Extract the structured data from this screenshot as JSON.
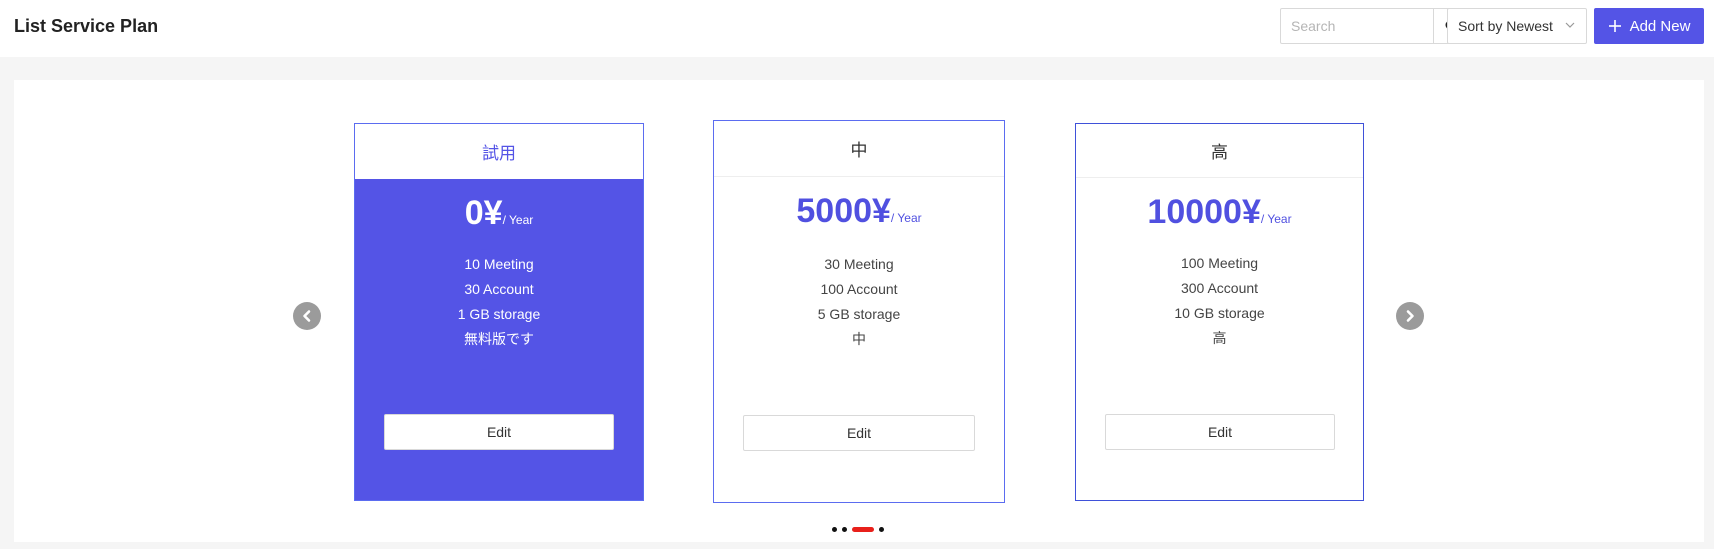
{
  "header": {
    "title": "List Service Plan",
    "search": {
      "placeholder": "Search",
      "value": ""
    },
    "sort": {
      "label": "Sort by Newest"
    },
    "add_button": "Add New"
  },
  "plans": [
    {
      "name": "試用",
      "price": "0¥",
      "period": "/ Year",
      "features": [
        "10 Meeting",
        "30 Account",
        "1 GB storage",
        "無料版です"
      ],
      "edit_label": "Edit",
      "active": true
    },
    {
      "name": "中",
      "price": "5000¥",
      "period": "/ Year",
      "features": [
        "30 Meeting",
        "100 Account",
        "5 GB storage",
        "中"
      ],
      "edit_label": "Edit",
      "active": false
    },
    {
      "name": "高",
      "price": "10000¥",
      "period": "/ Year",
      "features": [
        "100 Meeting",
        "300 Account",
        "10 GB storage",
        "高"
      ],
      "edit_label": "Edit",
      "active": false
    }
  ],
  "carousel": {
    "dot_count": 4,
    "active_dot": 2
  },
  "icons": {
    "search": "search-icon",
    "sort_chevron": "chevron-down-icon",
    "add": "plus-icon",
    "prev": "chevron-left-circle-icon",
    "next": "chevron-right-circle-icon"
  },
  "colors": {
    "accent": "#5454e6",
    "card_border": "#5b6cf0",
    "active_dot": "#e8201b",
    "arrow_bg": "#9b9b9b"
  }
}
